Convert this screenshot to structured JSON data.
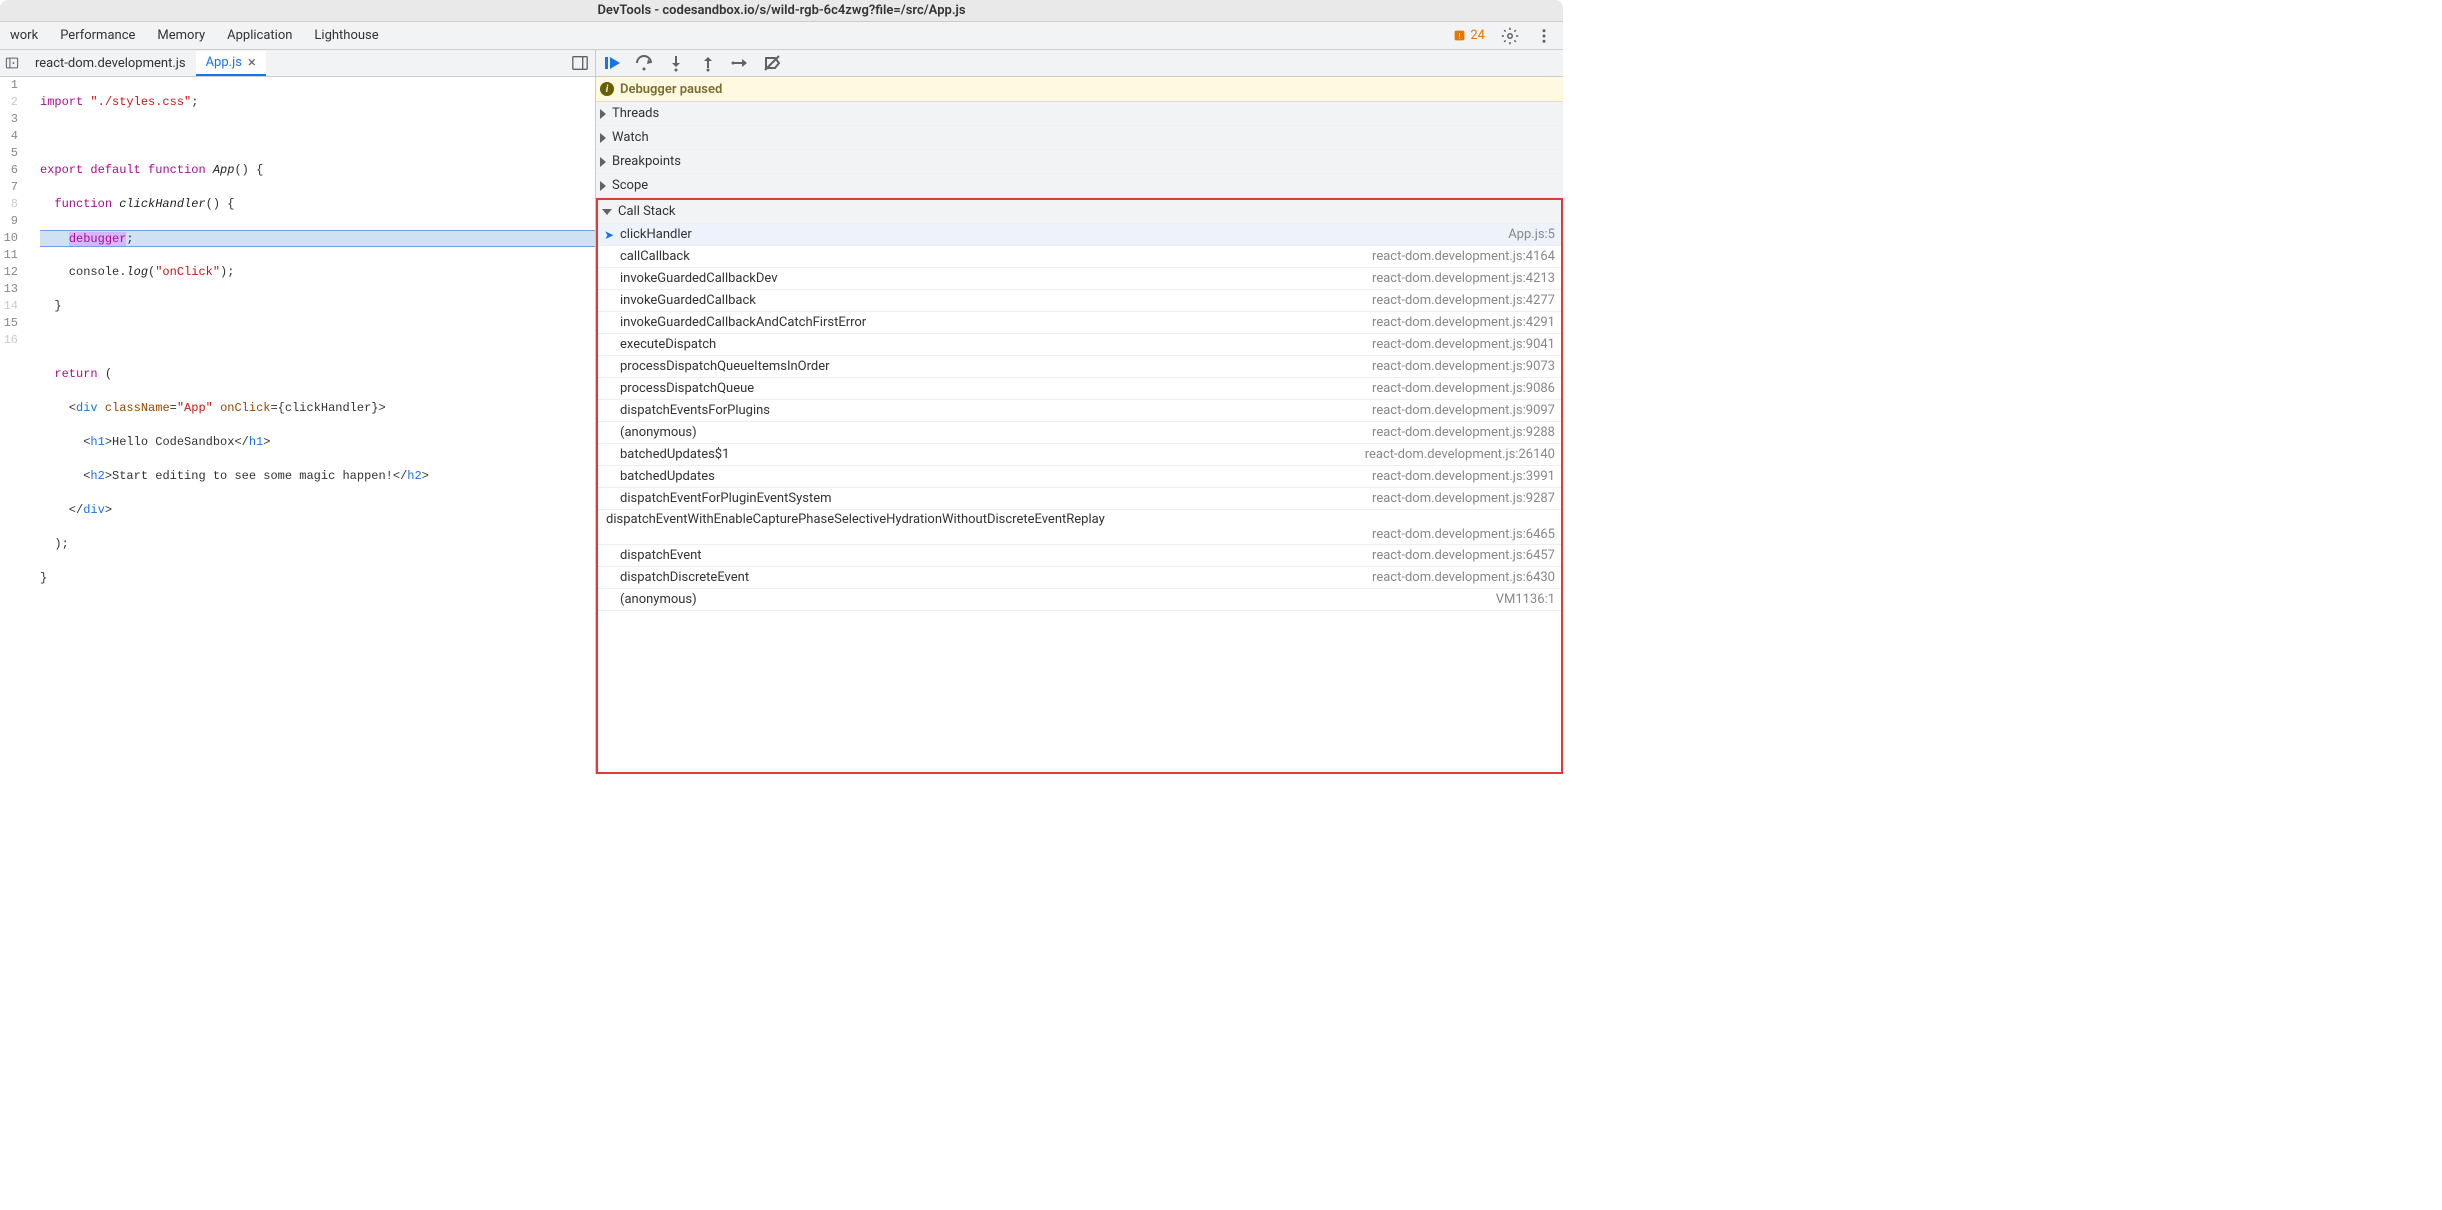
{
  "window": {
    "title": "DevTools - codesandbox.io/s/wild-rgb-6c4zwg?file=/src/App.js"
  },
  "tabs": {
    "network": "work",
    "performance": "Performance",
    "memory": "Memory",
    "application": "Application",
    "lighthouse": "Lighthouse"
  },
  "toolbar_right": {
    "warning_count": "24"
  },
  "file_tabs": {
    "inactive": "react-dom.development.js",
    "active": "App.js"
  },
  "code": {
    "l1a": "import",
    "l1b": " ",
    "l1c": "\"./styles.css\"",
    "l1d": ";",
    "l3a": "export",
    "l3b": " ",
    "l3c": "default",
    "l3d": " ",
    "l3e": "function",
    "l3f": " ",
    "l3g": "App",
    "l3h": "() {",
    "l4a": "  ",
    "l4b": "function",
    "l4c": " ",
    "l4d": "clickHandler",
    "l4e": "() {",
    "l5a": "    ",
    "l5b": "debugger",
    "l5c": ";",
    "l6a": "    console.",
    "l6b": "log",
    "l6c": "(",
    "l6d": "\"onClick\"",
    "l6e": ");",
    "l7": "  }",
    "l9a": "  ",
    "l9b": "return",
    "l9c": " (",
    "l10a": "    <",
    "l10b": "div",
    "l10c": " ",
    "l10d": "className",
    "l10e": "=",
    "l10f": "\"App\"",
    "l10g": " ",
    "l10h": "onClick",
    "l10i": "={clickHandler}>",
    "l11a": "      <",
    "l11b": "h1",
    "l11c": ">Hello CodeSandbox</",
    "l11d": "h1",
    "l11e": ">",
    "l12a": "      <",
    "l12b": "h2",
    "l12c": ">Start editing to see some magic happen!</",
    "l12d": "h2",
    "l12e": ">",
    "l13a": "    </",
    "l13b": "div",
    "l13c": ">",
    "l14": "  );",
    "l15": "}"
  },
  "line_numbers": [
    "1",
    "2",
    "3",
    "4",
    "5",
    "6",
    "7",
    "8",
    "9",
    "10",
    "11",
    "12",
    "13",
    "14",
    "15",
    "16"
  ],
  "debugger": {
    "paused_label": "Debugger paused"
  },
  "sections": {
    "threads": "Threads",
    "watch": "Watch",
    "breakpoints": "Breakpoints",
    "scope": "Scope",
    "callstack": "Call Stack"
  },
  "callstack": [
    {
      "fn": "clickHandler",
      "loc": "App.js:5",
      "active": true
    },
    {
      "fn": "callCallback",
      "loc": "react-dom.development.js:4164"
    },
    {
      "fn": "invokeGuardedCallbackDev",
      "loc": "react-dom.development.js:4213"
    },
    {
      "fn": "invokeGuardedCallback",
      "loc": "react-dom.development.js:4277"
    },
    {
      "fn": "invokeGuardedCallbackAndCatchFirstError",
      "loc": "react-dom.development.js:4291"
    },
    {
      "fn": "executeDispatch",
      "loc": "react-dom.development.js:9041"
    },
    {
      "fn": "processDispatchQueueItemsInOrder",
      "loc": "react-dom.development.js:9073"
    },
    {
      "fn": "processDispatchQueue",
      "loc": "react-dom.development.js:9086"
    },
    {
      "fn": "dispatchEventsForPlugins",
      "loc": "react-dom.development.js:9097"
    },
    {
      "fn": "(anonymous)",
      "loc": "react-dom.development.js:9288"
    },
    {
      "fn": "batchedUpdates$1",
      "loc": "react-dom.development.js:26140"
    },
    {
      "fn": "batchedUpdates",
      "loc": "react-dom.development.js:3991"
    },
    {
      "fn": "dispatchEventForPluginEventSystem",
      "loc": "react-dom.development.js:9287"
    },
    {
      "fn": "dispatchEventWithEnableCapturePhaseSelectiveHydrationWithoutDiscreteEventReplay",
      "loc": "react-dom.development.js:6465",
      "twolines": true
    },
    {
      "fn": "dispatchEvent",
      "loc": "react-dom.development.js:6457"
    },
    {
      "fn": "dispatchDiscreteEvent",
      "loc": "react-dom.development.js:6430"
    },
    {
      "fn": "(anonymous)",
      "loc": "VM1136:1"
    }
  ]
}
